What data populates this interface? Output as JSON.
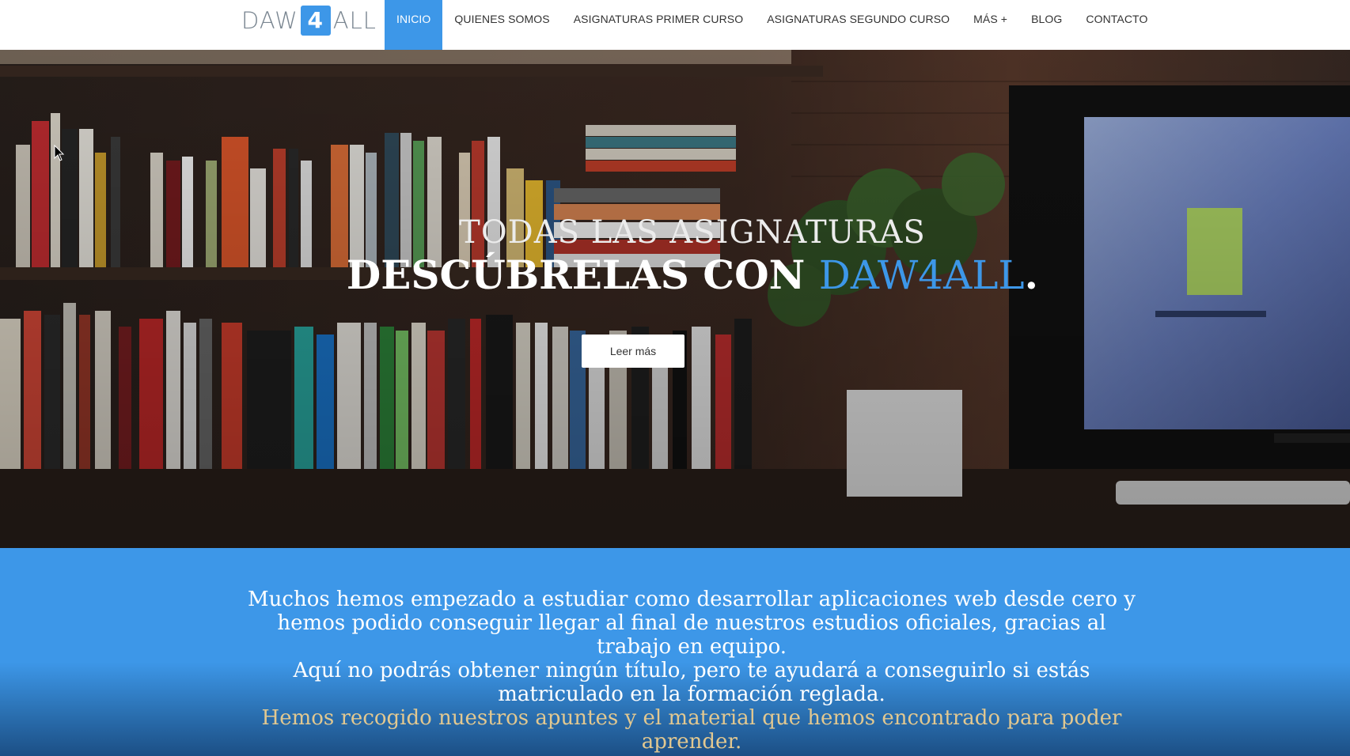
{
  "brand": {
    "logo_left": "DAW",
    "logo_badge": "4",
    "logo_right": "ALL"
  },
  "nav": {
    "items": [
      {
        "label": "INICIO",
        "active": true
      },
      {
        "label": "QUIENES SOMOS"
      },
      {
        "label": "ASIGNATURAS PRIMER CURSO"
      },
      {
        "label": "ASIGNATURAS SEGUNDO CURSO"
      },
      {
        "label": "MÁS +"
      },
      {
        "label": "BLOG"
      },
      {
        "label": "CONTACTO"
      }
    ]
  },
  "hero": {
    "subtitle": "TODAS LAS ASIGNATURAS",
    "title_main": "DESCÚBRELAS CON ",
    "title_brand": "DAW4ALL",
    "title_end": ".",
    "button_label": "Leer más"
  },
  "info": {
    "line1": "Muchos hemos empezado a estudiar como desarrollar aplicaciones web desde cero y hemos podido conseguir llegar al final de nuestros estudios oficiales, gracias al trabajo en equipo.",
    "line2": "Aquí no podrás obtener ningún título, pero te ayudará a conseguirlo si estás matriculado en la formación reglada.",
    "line3": "Hemos recogido nuestros apuntes y el material que hemos encontrado para poder aprender."
  },
  "colors": {
    "accent": "#3d97e8",
    "muted_text": "#e2c890"
  }
}
